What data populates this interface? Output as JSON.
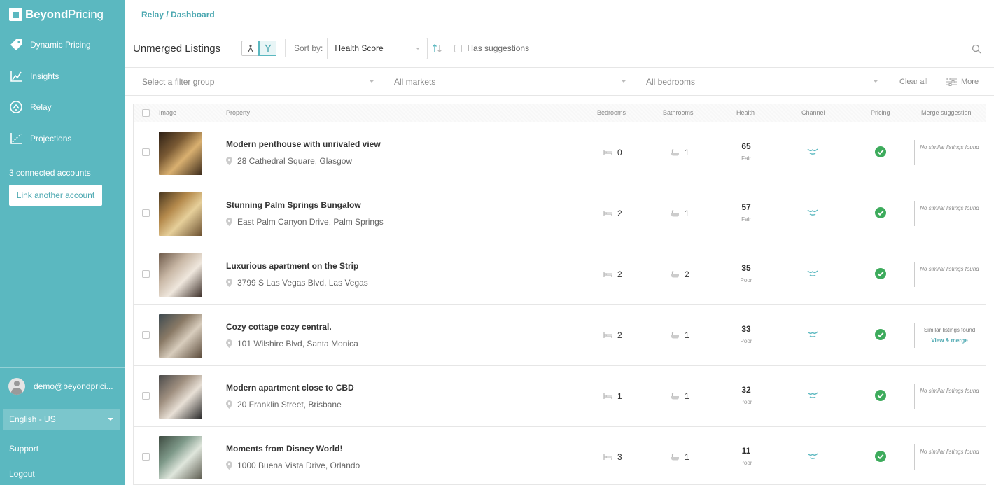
{
  "app": {
    "logo_text_bold": "Beyond",
    "logo_text": "Pricing"
  },
  "sidebar": {
    "items": [
      {
        "label": "Dynamic Pricing",
        "icon": "tag-icon"
      },
      {
        "label": "Insights",
        "icon": "chart-line-icon"
      },
      {
        "label": "Relay",
        "icon": "relay-icon"
      },
      {
        "label": "Projections",
        "icon": "projection-chart-icon"
      }
    ],
    "accounts_text": "3 connected accounts",
    "link_button": "Link another account",
    "user_email": "demo@beyondprici...",
    "language": "English - US",
    "support": "Support",
    "logout": "Logout"
  },
  "header": {
    "breadcrumb": "Relay / Dashboard"
  },
  "toolbar": {
    "title": "Unmerged Listings",
    "sort_label": "Sort by:",
    "sort_value": "Health Score",
    "has_suggestions": "Has suggestions"
  },
  "filters": {
    "group_placeholder": "Select a filter group",
    "markets": "All markets",
    "bedrooms": "All bedrooms",
    "clear_all": "Clear all",
    "more": "More"
  },
  "table": {
    "columns": {
      "image": "Image",
      "property": "Property",
      "bedrooms": "Bedrooms",
      "bathrooms": "Bathrooms",
      "health": "Health",
      "channel": "Channel",
      "pricing": "Pricing",
      "merge": "Merge suggestion"
    },
    "rows": [
      {
        "name": "Modern penthouse with unrivaled view",
        "address": "28 Cathedral Square, Glasgow",
        "bedrooms": "0",
        "bathrooms": "1",
        "health": "65",
        "health_label": "Fair",
        "merge": "No similar listings found",
        "merge_link": ""
      },
      {
        "name": "Stunning Palm Springs Bungalow",
        "address": "East Palm Canyon Drive, Palm Springs",
        "bedrooms": "2",
        "bathrooms": "1",
        "health": "57",
        "health_label": "Fair",
        "merge": "No similar listings found",
        "merge_link": ""
      },
      {
        "name": "Luxurious apartment on the Strip",
        "address": "3799 S Las Vegas Blvd, Las Vegas",
        "bedrooms": "2",
        "bathrooms": "2",
        "health": "35",
        "health_label": "Poor",
        "merge": "No similar listings found",
        "merge_link": ""
      },
      {
        "name": "Cozy cottage cozy central.",
        "address": "101 Wilshire Blvd, Santa Monica",
        "bedrooms": "2",
        "bathrooms": "1",
        "health": "33",
        "health_label": "Poor",
        "merge": "Similar listings found",
        "merge_link": "View & merge"
      },
      {
        "name": "Modern apartment close to CBD",
        "address": "20 Franklin Street, Brisbane",
        "bedrooms": "1",
        "bathrooms": "1",
        "health": "32",
        "health_label": "Poor",
        "merge": "No similar listings found",
        "merge_link": ""
      },
      {
        "name": "Moments from Disney World!",
        "address": "1000 Buena Vista Drive, Orlando",
        "bedrooms": "3",
        "bathrooms": "1",
        "health": "11",
        "health_label": "Poor",
        "merge": "No similar listings found",
        "merge_link": ""
      }
    ]
  },
  "colors": {
    "sidebar": "#5bb8c0",
    "accent": "#4aa7b0",
    "success": "#3dab5c"
  }
}
